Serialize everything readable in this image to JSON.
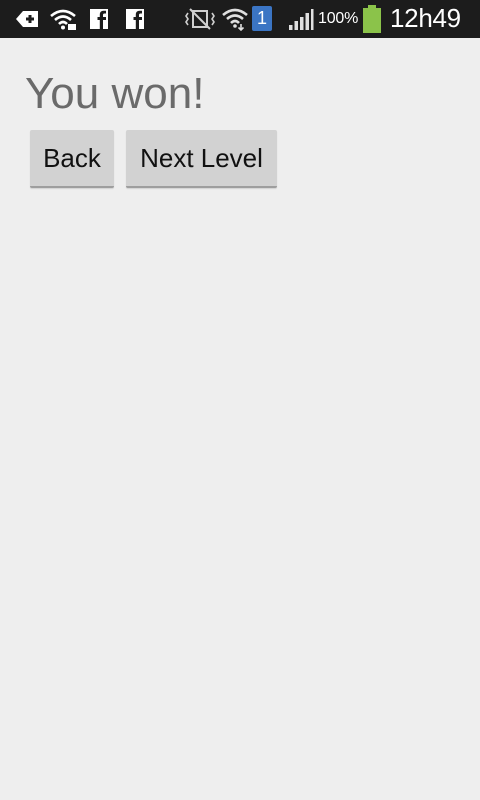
{
  "status_bar": {
    "left_icons": [
      "exchange-icon",
      "wifi-notification-icon",
      "facebook-icon",
      "facebook-icon"
    ],
    "right_icons": [
      "vibrate-mute-icon",
      "wifi-icon",
      "sim-1-icon",
      "signal-icon",
      "battery-icon"
    ],
    "sim_label": "1",
    "battery_percent": "100%",
    "time": "12h49",
    "battery_color": "#8bc34a"
  },
  "screen": {
    "title": "You won!",
    "back_label": "Back",
    "next_label": "Next Level"
  }
}
